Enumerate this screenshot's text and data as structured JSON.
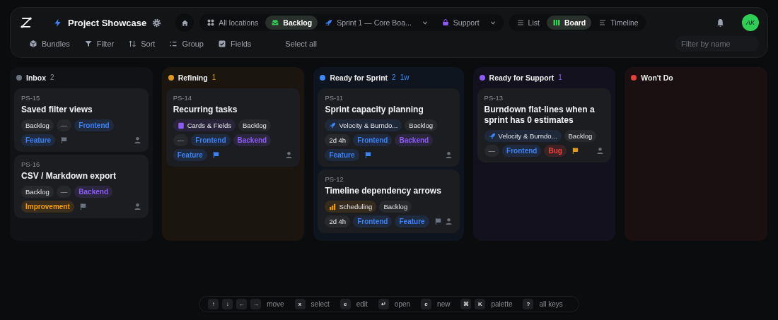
{
  "header": {
    "title": "Project Showcase",
    "locations": [
      {
        "label": "All locations",
        "selected": false,
        "kind": "grid",
        "dropdown": false
      },
      {
        "label": "Backlog",
        "selected": true,
        "kind": "inbox",
        "dropdown": false
      },
      {
        "label": "Sprint 1 — Core Boa...",
        "selected": false,
        "kind": "rocket",
        "dropdown": true
      },
      {
        "label": "Support",
        "selected": false,
        "kind": "bag",
        "dropdown": true
      }
    ],
    "views": [
      {
        "label": "List",
        "selected": false,
        "kind": "list"
      },
      {
        "label": "Board",
        "selected": true,
        "kind": "board"
      },
      {
        "label": "Timeline",
        "selected": false,
        "kind": "timeline"
      }
    ],
    "avatar": "AK"
  },
  "toolbar": {
    "actions": [
      {
        "label": "Bundles",
        "kind": "cube"
      },
      {
        "label": "Filter",
        "kind": "funnel"
      },
      {
        "label": "Sort",
        "kind": "sort"
      },
      {
        "label": "Group",
        "kind": "group"
      },
      {
        "label": "Fields",
        "kind": "check"
      },
      {
        "label": "Select all",
        "kind": "none"
      }
    ],
    "search": {
      "placeholder": "Filter by name"
    }
  },
  "columns": [
    {
      "name": "Inbox",
      "color": "#6b7280",
      "count": "2",
      "cards": [
        {
          "id": "PS-15",
          "title": "Saved filter views",
          "rows": [
            {
              "items": [
                {
                  "kind": "status",
                  "text": "Backlog"
                },
                {
                  "kind": "priority",
                  "text": "—"
                },
                {
                  "kind": "tag",
                  "text": "Frontend",
                  "color": "#3b82f6"
                }
              ]
            },
            {
              "items": [
                {
                  "kind": "tag",
                  "text": "Feature",
                  "color": "#3b82f6"
                },
                {
                  "kind": "flag",
                  "color": "#6b7280"
                }
              ]
            }
          ]
        },
        {
          "id": "PS-16",
          "title": "CSV / Markdown export",
          "rows": [
            {
              "items": [
                {
                  "kind": "status",
                  "text": "Backlog"
                },
                {
                  "kind": "priority",
                  "text": "—"
                },
                {
                  "kind": "tag",
                  "text": "Backend",
                  "color": "#8b5cf6"
                }
              ]
            },
            {
              "items": [
                {
                  "kind": "tag",
                  "text": "Improvement",
                  "color": "#f59e0b"
                },
                {
                  "kind": "flag",
                  "color": "#6b7280"
                }
              ]
            }
          ]
        }
      ]
    },
    {
      "name": "Refining",
      "color": "#e09a1a",
      "count": "1",
      "cards": [
        {
          "id": "PS-14",
          "title": "Recurring tasks",
          "rows": [
            {
              "items": [
                {
                  "kind": "project",
                  "text": "Cards & Fields",
                  "color": "#8b5cf6"
                },
                {
                  "kind": "status",
                  "text": "Backlog"
                }
              ]
            },
            {
              "items": [
                {
                  "kind": "priority",
                  "text": "—"
                },
                {
                  "kind": "tag",
                  "text": "Frontend",
                  "color": "#3b82f6"
                },
                {
                  "kind": "tag",
                  "text": "Backend",
                  "color": "#8b5cf6"
                }
              ]
            },
            {
              "items": [
                {
                  "kind": "tag",
                  "text": "Feature",
                  "color": "#3b82f6"
                },
                {
                  "kind": "flag",
                  "color": "#3b82f6"
                }
              ]
            }
          ]
        }
      ]
    },
    {
      "name": "Ready for Sprint",
      "color": "#3b8cf6",
      "count": "2",
      "extra": "1w",
      "cards": [
        {
          "id": "PS-11",
          "title": "Sprint capacity planning",
          "rows": [
            {
              "items": [
                {
                  "kind": "project",
                  "text": "Velocity & Burndo...",
                  "color": "#3b82f6"
                },
                {
                  "kind": "status",
                  "text": "Backlog"
                }
              ]
            },
            {
              "items": [
                {
                  "kind": "estimate",
                  "text": "2d 4h"
                },
                {
                  "kind": "tag",
                  "text": "Frontend",
                  "color": "#3b82f6"
                },
                {
                  "kind": "tag",
                  "text": "Backend",
                  "color": "#8b5cf6"
                }
              ]
            },
            {
              "items": [
                {
                  "kind": "tag",
                  "text": "Feature",
                  "color": "#3b82f6"
                },
                {
                  "kind": "flag",
                  "color": "#3b82f6"
                }
              ]
            }
          ]
        },
        {
          "id": "PS-12",
          "title": "Timeline dependency arrows",
          "rows": [
            {
              "items": [
                {
                  "kind": "project",
                  "text": "Scheduling",
                  "color": "#f59e0b"
                },
                {
                  "kind": "status",
                  "text": "Backlog"
                }
              ]
            },
            {
              "items": [
                {
                  "kind": "estimate",
                  "text": "2d 4h"
                },
                {
                  "kind": "tag",
                  "text": "Frontend",
                  "color": "#3b82f6"
                },
                {
                  "kind": "tag",
                  "text": "Feature",
                  "color": "#3b82f6"
                },
                {
                  "kind": "flag",
                  "color": "#6b7280"
                }
              ]
            }
          ]
        }
      ]
    },
    {
      "name": "Ready for Support",
      "color": "#8b5cf6",
      "count": "1",
      "cards": [
        {
          "id": "PS-13",
          "title": "Burndown flat-lines when a sprint has 0 estimates",
          "rows": [
            {
              "items": [
                {
                  "kind": "project",
                  "text": "Velocity & Burndo...",
                  "color": "#3b82f6"
                },
                {
                  "kind": "status",
                  "text": "Backlog"
                }
              ]
            },
            {
              "items": [
                {
                  "kind": "priority",
                  "text": "—"
                },
                {
                  "kind": "tag",
                  "text": "Frontend",
                  "color": "#3b82f6"
                },
                {
                  "kind": "tag",
                  "text": "Bug",
                  "color": "#ef4444"
                },
                {
                  "kind": "flag",
                  "color": "#e09a1a"
                }
              ]
            }
          ]
        }
      ]
    },
    {
      "name": "Won't Do",
      "color": "#e5403a"
    }
  ],
  "shortcuts": [
    {
      "keys": [
        "↑",
        "↓",
        "←",
        "→"
      ],
      "label": "move"
    },
    {
      "keys": [
        "x"
      ],
      "label": "select"
    },
    {
      "keys": [
        "e"
      ],
      "label": "edit"
    },
    {
      "keys": [
        "↵"
      ],
      "label": "open"
    },
    {
      "keys": [
        "c"
      ],
      "label": "new"
    },
    {
      "keys": [
        "⌘",
        "K"
      ],
      "label": "palette"
    },
    {
      "keys": [
        "?"
      ],
      "label": "all keys"
    }
  ]
}
